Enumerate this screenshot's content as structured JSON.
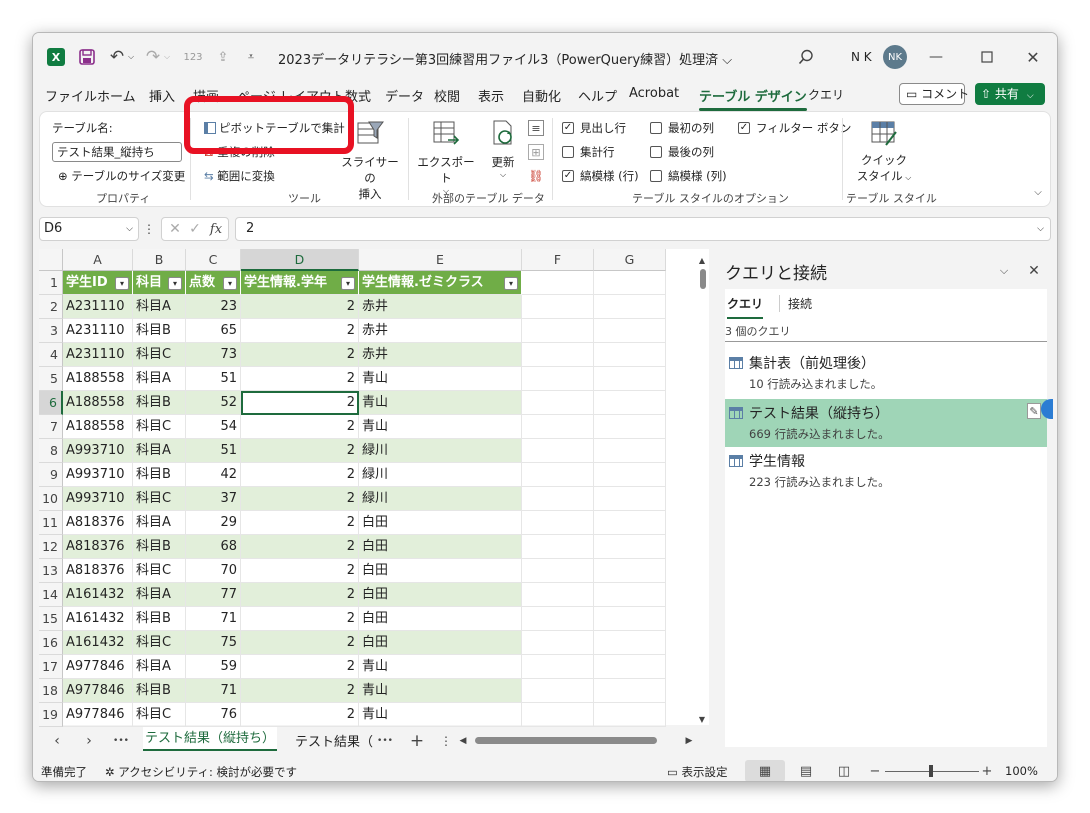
{
  "app": {
    "title": "2023データリテラシー第3回練習用ファイル3（PowerQuery練習）処理済 ⌵",
    "user_initials": "N K",
    "avatar_text": "NK"
  },
  "tabs": [
    "ファイル",
    "ホーム",
    "挿入",
    "描画",
    "ページ レイアウト",
    "数式",
    "データ",
    "校閲",
    "表示",
    "自動化",
    "ヘルプ",
    "Acrobat",
    "テーブル デザイン",
    "クエリ"
  ],
  "header_buttons": {
    "comment": "コメント",
    "share": "共有"
  },
  "ribbon": {
    "table_name_label": "テーブル名:",
    "table_name_value": "テスト結果_縦持ち",
    "resize_table": "テーブルのサイズ変更",
    "properties_group": "プロパティ",
    "pivot_summary": "ピボットテーブルで集計",
    "remove_duplicates": "重複の削除",
    "convert_to_range": "範囲に変換",
    "slicer_line1": "スライサーの",
    "slicer_line2": "挿入",
    "tools_group": "ツール",
    "export": "エクスポート",
    "refresh": "更新",
    "external_group": "外部のテーブル データ",
    "opt_header_row": "見出し行",
    "opt_total_row": "集計行",
    "opt_banded_rows": "縞模様 (行)",
    "opt_first_col": "最初の列",
    "opt_last_col": "最後の列",
    "opt_banded_cols": "縞模様 (列)",
    "opt_filter_btn": "フィルター ボタン",
    "options_group": "テーブル スタイルのオプション",
    "quick_style_line1": "クイック",
    "quick_style_line2": "スタイル",
    "styles_group": "テーブル スタイル"
  },
  "formula_bar": {
    "name_box": "D6",
    "value": "2",
    "fx": "fx"
  },
  "columns": [
    "A",
    "B",
    "C",
    "D",
    "E",
    "F",
    "G"
  ],
  "table": {
    "headers": [
      "学生ID",
      "科目",
      "点数",
      "学生情報.学年",
      "学生情報.ゼミクラス"
    ],
    "rows": [
      [
        "A231110",
        "科目A",
        "23",
        "2",
        "赤井"
      ],
      [
        "A231110",
        "科目B",
        "65",
        "2",
        "赤井"
      ],
      [
        "A231110",
        "科目C",
        "73",
        "2",
        "赤井"
      ],
      [
        "A188558",
        "科目A",
        "51",
        "2",
        "青山"
      ],
      [
        "A188558",
        "科目B",
        "52",
        "2",
        "青山"
      ],
      [
        "A188558",
        "科目C",
        "54",
        "2",
        "青山"
      ],
      [
        "A993710",
        "科目A",
        "51",
        "2",
        "緑川"
      ],
      [
        "A993710",
        "科目B",
        "42",
        "2",
        "緑川"
      ],
      [
        "A993710",
        "科目C",
        "37",
        "2",
        "緑川"
      ],
      [
        "A818376",
        "科目A",
        "29",
        "2",
        "白田"
      ],
      [
        "A818376",
        "科目B",
        "68",
        "2",
        "白田"
      ],
      [
        "A818376",
        "科目C",
        "70",
        "2",
        "白田"
      ],
      [
        "A161432",
        "科目A",
        "77",
        "2",
        "白田"
      ],
      [
        "A161432",
        "科目B",
        "71",
        "2",
        "白田"
      ],
      [
        "A161432",
        "科目C",
        "75",
        "2",
        "白田"
      ],
      [
        "A977846",
        "科目A",
        "59",
        "2",
        "青山"
      ],
      [
        "A977846",
        "科目B",
        "71",
        "2",
        "青山"
      ],
      [
        "A977846",
        "科目C",
        "76",
        "2",
        "青山"
      ]
    ]
  },
  "row_numbers": [
    "1",
    "2",
    "3",
    "4",
    "5",
    "6",
    "7",
    "8",
    "9",
    "10",
    "11",
    "12",
    "13",
    "14",
    "15",
    "16",
    "17",
    "18",
    "19"
  ],
  "sheets": {
    "active": "テスト結果（縦持ち）",
    "other": "テスト結果（",
    "more": "•••"
  },
  "query_pane": {
    "title": "クエリと接続",
    "tab_queries": "クエリ",
    "tab_connections": "接続",
    "count": "3 個のクエリ",
    "queries": [
      {
        "name": "集計表（前処理後）",
        "status": "10 行読み込まれました。"
      },
      {
        "name": "テスト結果（縦持ち）",
        "status": "669 行読み込まれました。"
      },
      {
        "name": "学生情報",
        "status": "223 行読み込まれました。"
      }
    ]
  },
  "status_bar": {
    "ready": "準備完了",
    "accessibility": "アクセシビリティ: 検討が必要です",
    "display_settings": "表示設定",
    "zoom": "100%"
  },
  "colors": {
    "accent": "#1e6b3d",
    "table_header": "#70ad47",
    "table_band": "#e2efda",
    "highlight": "#e81123",
    "selected_query": "#9fd5b7"
  }
}
